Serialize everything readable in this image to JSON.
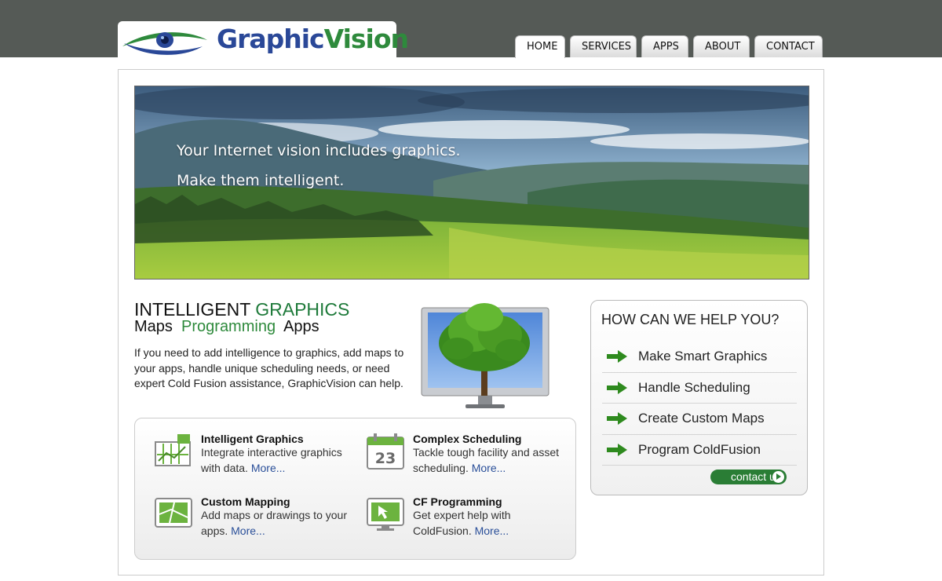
{
  "brand": {
    "name_part1": "Graphic",
    "name_part2": "Vision",
    "icon": "eye-logo-icon"
  },
  "nav": {
    "home": "HOME",
    "services": "SERVICES",
    "apps": "APPS",
    "about": "ABOUT",
    "contact": "CONTACT",
    "active": "HOME"
  },
  "hero": {
    "line1": "Your Internet vision includes graphics.",
    "line2": "Make them intelligent."
  },
  "intro": {
    "title_part1": "INTELLIGENT",
    "title_part2": "GRAPHICS",
    "sub_maps": "Maps",
    "sub_programming": "Programming",
    "sub_apps": "Apps",
    "body": "If you need to add intelligence to graphics, add maps to your apps, handle unique scheduling needs, or need expert Cold Fusion assistance, GraphicVision can help."
  },
  "features": [
    {
      "title": "Intelligent Graphics",
      "desc": "Integrate interactive graphics with data.",
      "more": "More...",
      "icon": "chart-graphic-icon"
    },
    {
      "title": "Complex Scheduling",
      "desc": "Tackle tough facility and asset scheduling.",
      "more": "More...",
      "icon": "calendar-icon",
      "icon_text": "23"
    },
    {
      "title": "Custom Mapping",
      "desc": "Add maps or drawings to your apps.",
      "more": "More...",
      "icon": "map-icon"
    },
    {
      "title": "CF Programming",
      "desc": "Get expert help with ColdFusion.",
      "more": "More...",
      "icon": "monitor-cursor-icon"
    }
  ],
  "help": {
    "title": "HOW CAN WE HELP YOU?",
    "items": [
      {
        "label": "Make Smart Graphics"
      },
      {
        "label": "Handle Scheduling"
      },
      {
        "label": "Create Custom Maps"
      },
      {
        "label": "Program ColdFusion"
      }
    ],
    "contact_label": "contact us"
  },
  "colors": {
    "topbar": "#555a56",
    "accent_green": "#2e8a3c",
    "brand_blue": "#2a4898",
    "link_blue": "#2a4f99"
  }
}
